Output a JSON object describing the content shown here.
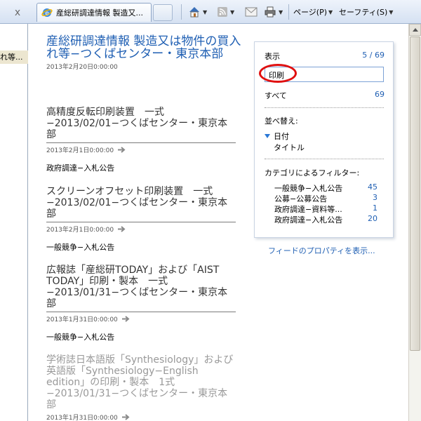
{
  "browser": {
    "close_glyph": "x",
    "tab_title": "産総研調達情報 製造又...",
    "commands": {
      "page_label": "ページ(P)",
      "safety_label": "セーフティ(S)"
    },
    "icons": [
      "close-icon",
      "ie-globe-icon",
      "home-icon",
      "feed-icon",
      "mail-icon",
      "print-icon",
      "chevron-down-icon"
    ]
  },
  "left_pane": {
    "item": "れ等..."
  },
  "feed": {
    "title": "産総研調達情報 製造又は物件の買入れ等−つくばセンター・東京本部",
    "date": "2013年2月20日0:00:00"
  },
  "entries": [
    {
      "title": "高精度反転印刷装置　一式−2013/02/01−つくばセンター・東京本部",
      "date": "2013年2月1日0:00:00",
      "category": "政府調達−入札公告"
    },
    {
      "title": "スクリーンオフセット印刷装置　一式−2013/02/01−つくばセンター・東京本部",
      "date": "2013年2月1日0:00:00",
      "category": "一般競争−入札公告"
    },
    {
      "title": "広報誌「産総研TODAY」および「AIST TODAY」印刷・製本　一式−2013/01/31−つくばセンター・東京本部",
      "date": "2013年1月31日0:00:00",
      "category": "一般競争−入札公告"
    },
    {
      "title": "学術誌日本語版「Synthesiology」および英語版「Synthesiology−English edition」の印刷・製本　1式−2013/01/31−つくばセンター・東京本部",
      "date": "2013年1月31日0:00:00",
      "category": ""
    }
  ],
  "panel": {
    "display_label": "表示",
    "display_count": "5 / 69",
    "search_value": "印刷",
    "all_label": "すべて",
    "all_count": "69",
    "sort_label": "並べ替え:",
    "sort_date": "日付",
    "sort_title": "タイトル",
    "filter_label": "カテゴリによるフィルター:",
    "filters": [
      {
        "label": "一般競争−入札公告",
        "count": "45"
      },
      {
        "label": "公募−公募公告",
        "count": "3"
      },
      {
        "label": "政府調達−資料等...",
        "count": "1"
      },
      {
        "label": "政府調達−入札公告",
        "count": "20"
      }
    ],
    "accent_color": "#1f5fb3",
    "highlight_color": "#e01010"
  },
  "props_link": "フィードのプロパティを表示..."
}
